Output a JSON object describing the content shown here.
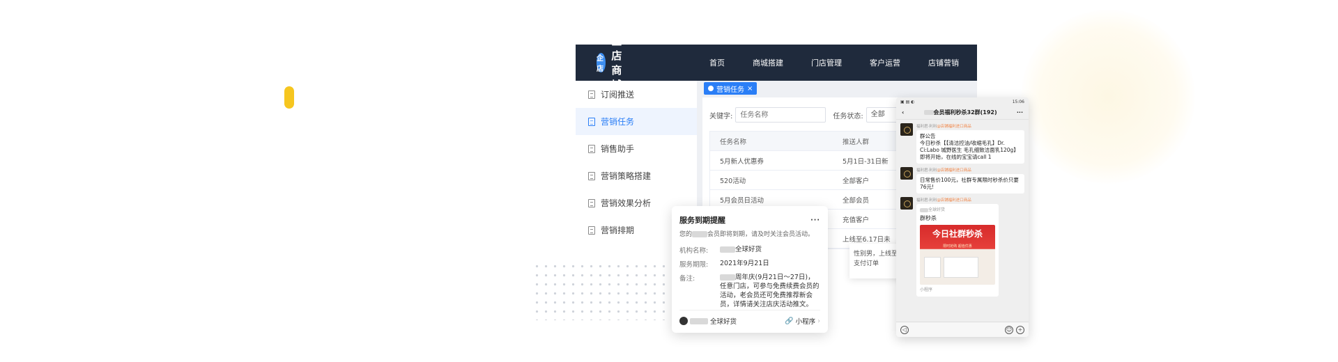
{
  "header": {
    "logo_mark": "企店",
    "brand": "企店商城",
    "nav": [
      "首页",
      "商城搭建",
      "门店管理",
      "客户运营",
      "店铺营销"
    ]
  },
  "sidebar": {
    "items": [
      {
        "label": "订阅推送",
        "active": false
      },
      {
        "label": "营销任务",
        "active": true
      },
      {
        "label": "销售助手",
        "active": false
      },
      {
        "label": "营销策略搭建",
        "active": false
      },
      {
        "label": "营销效果分析",
        "active": false
      },
      {
        "label": "营销排期",
        "active": false
      }
    ]
  },
  "tabs": [
    {
      "label": "营销任务",
      "close": "×"
    }
  ],
  "filter": {
    "keyword_label": "关键字:",
    "keyword_placeholder": "任务名称",
    "status_label": "任务状态:",
    "status_value": "全部"
  },
  "table": {
    "headers": [
      "任务名称",
      "推送人群"
    ],
    "rows": [
      [
        "5月新人优惠券",
        "5月1日-31日新"
      ],
      [
        "520活动",
        "全部客户"
      ],
      [
        "5月会员日活动",
        "全部会员"
      ],
      [
        "",
        "充值客户"
      ],
      [
        "",
        "上线至6.17日未"
      ]
    ]
  },
  "tooltip": {
    "line1": "性别男，上线至",
    "line2": "支付订单"
  },
  "notice_card": {
    "title": "服务到期提醒",
    "more": "···",
    "subtitle": "会员即将到期，请及时关注会员活动。",
    "subtitle_prefix": "您的",
    "fields": [
      {
        "key": "机构名称:",
        "value": "全球好货"
      },
      {
        "key": "服务期限:",
        "value": "2021年9月21日"
      },
      {
        "key": "备注:",
        "value": "周年庆(9月21日～27日)，任意门店，可参与免费续费会员的活动，老会员还可免费推荐新会员，详情请关注店庆活动推文。"
      }
    ],
    "footer_left": "全球好货",
    "footer_right": "小程序"
  },
  "phone": {
    "status_left": "▣ ▤ ◐",
    "status_right": "15:06",
    "chat_title": "会员福利秒杀32群(192)",
    "messages": [
      {
        "sender": "福利君·利利",
        "sender_tag": "@店铺福利进口商品",
        "text": "群公告\n今日秒杀【【清洁控油/收缩毛孔】Dr. Ci:Labo 城野医生 毛孔细致洁面乳120g】即将开始，在线的宝宝请call 1"
      },
      {
        "sender": "福利君·利利",
        "sender_tag": "@店铺福利进口商品",
        "text": "日常售价100元，社群专属限时秒杀价只要76元!"
      },
      {
        "sender": "福利君·利利",
        "sender_tag": "@店铺福利进口商品",
        "mini_name": "全球好货",
        "mini_title": "群秒杀",
        "poster_title": "今日社群秒杀",
        "poster_sub": "限时抢购 超值优惠",
        "mini_label": "小程序"
      }
    ]
  }
}
